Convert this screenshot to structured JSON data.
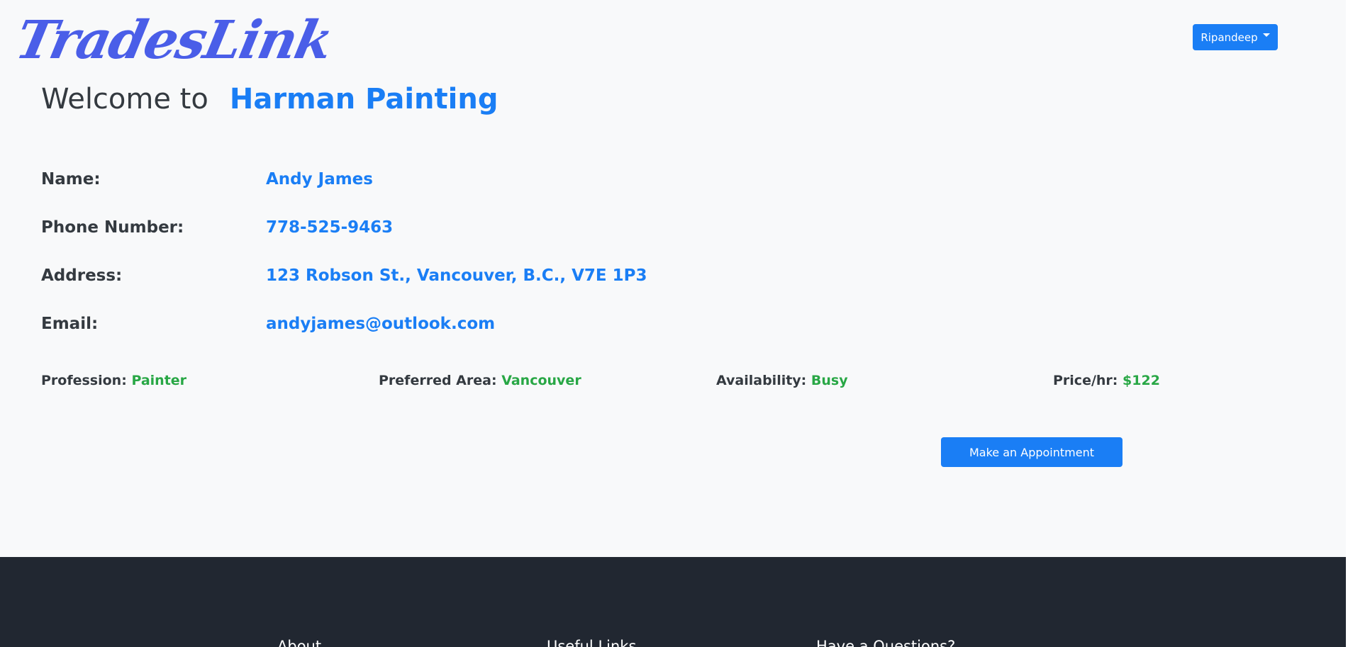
{
  "header": {
    "logo_text": "TradesLink",
    "user_menu_label": "Ripandeep"
  },
  "welcome": {
    "lead": "Welcome to",
    "business_name": "Harman Painting"
  },
  "details": [
    {
      "label": "Name:",
      "value": "Andy James"
    },
    {
      "label": "Phone Number:",
      "value": "778-525-9463"
    },
    {
      "label": "Address:",
      "value": "123 Robson St., Vancouver, B.C., V7E 1P3"
    },
    {
      "label": "Email:",
      "value": "andyjames@outlook.com"
    }
  ],
  "meta": [
    {
      "label": "Profession:",
      "value": "Painter"
    },
    {
      "label": "Preferred Area:",
      "value": "Vancouver"
    },
    {
      "label": "Availability:",
      "value": "Busy"
    },
    {
      "label": "Price/hr:",
      "value": "$122"
    }
  ],
  "actions": {
    "appointment_label": "Make an Appointment"
  },
  "footer": {
    "headings": [
      "About",
      "Useful Links",
      "Have a Questions?"
    ]
  },
  "colors": {
    "primary": "#1a7ef5",
    "logo": "#4a5ee8",
    "success": "#28a745",
    "footer_bg": "#212731",
    "page_bg": "#f8f9fa"
  }
}
